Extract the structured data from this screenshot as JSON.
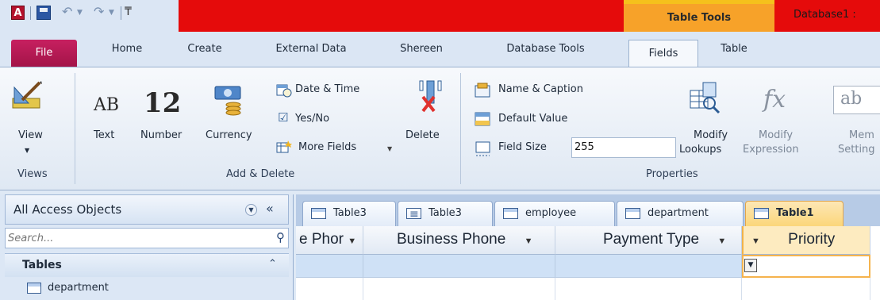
{
  "window": {
    "tool_context": "Table Tools",
    "db_title": "Database1 :"
  },
  "ribbon_tabs": [
    "File",
    "Home",
    "Create",
    "External Data",
    "Shereen",
    "Database Tools",
    "Fields",
    "Table"
  ],
  "ribbon": {
    "views": {
      "view_label": "View",
      "group": "Views"
    },
    "add_delete": {
      "text_glyph": "AB",
      "text_label": "Text",
      "number_glyph": "12",
      "number_label": "Number",
      "currency_label": "Currency",
      "date_time": "Date & Time",
      "yes_no": "Yes/No",
      "more_fields": "More Fields",
      "delete": "Delete",
      "group": "Add & Delete"
    },
    "properties": {
      "name_caption": "Name & Caption",
      "default_value": "Default Value",
      "field_size_label": "Field Size",
      "field_size_value": "255",
      "modify_lookups_1": "Modify",
      "modify_lookups_2": "Lookups",
      "modify_expression_1": "Modify",
      "modify_expression_2": "Expression",
      "memo_1": "Mem",
      "memo_2": "Setting",
      "fx_glyph": "fx",
      "ab_glyph": "ab",
      "group": "Properties"
    }
  },
  "nav": {
    "title": "All Access Objects",
    "search_placeholder": "Search...",
    "section": "Tables",
    "items": [
      "department"
    ]
  },
  "doc_tabs": [
    "Table3",
    "Table3",
    "employee",
    "department",
    "Table1"
  ],
  "datasheet": {
    "columns": [
      "e Phor",
      "Business Phone",
      "Payment Type",
      "Priority"
    ]
  },
  "colors": {
    "title_red": "#e50b0b",
    "table_tools": "#f7a229",
    "file_tab": "#b8185a",
    "selected_cell_border": "#f5b34d"
  }
}
